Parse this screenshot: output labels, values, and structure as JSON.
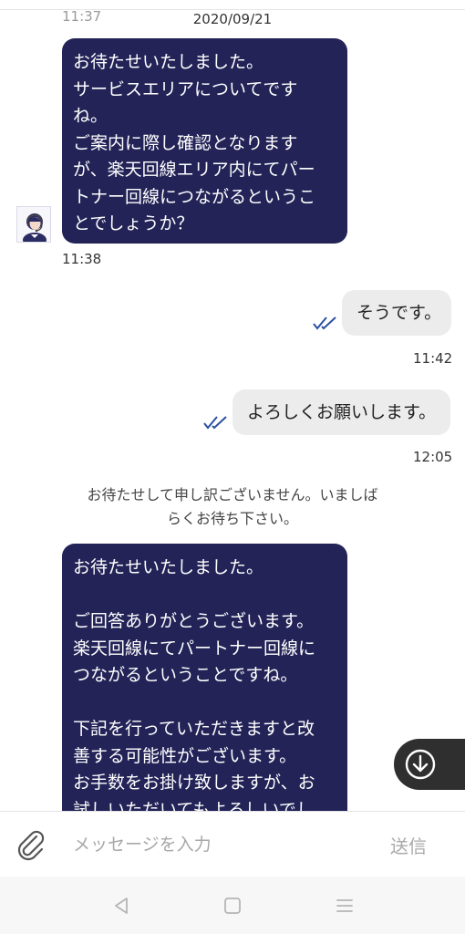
{
  "chat": {
    "prev_time": "11:37",
    "date": "2020/09/21",
    "agent_message_1": "お待たせいたしました。\nサービスエリアについてです\nね。\nご案内に際し確認となります\nが、楽天回線エリア内にてパー\nトナー回線につながるというこ\nとでしょうか？",
    "agent_time_1": "11:38",
    "user_message_1": "そうです。",
    "user_time_1": "11:42",
    "user_message_2": "よろしくお願いします。",
    "user_time_2": "12:05",
    "system_message": "お待たせして申し訳ございません。いましば\nらくお待ち下さい。",
    "agent_message_2": "お待たせいたしました。\n\nご回答ありがとうございます。\n楽天回線にてパートナー回線に\nつながるということですね。\n\n下記を行っていただきますと改\n善する可能性がございます。\nお手数をお掛け致しますが、お\n試しいただいてもよろしいでし"
  },
  "input": {
    "placeholder": "メッセージを入力",
    "send_label": "送信"
  },
  "icons": {
    "attach": "paperclip-icon",
    "read": "double-check-icon",
    "scroll_down": "arrow-down-circle-icon",
    "nav_back": "back-triangle-icon",
    "nav_home": "home-square-icon",
    "nav_menu": "menu-lines-icon"
  },
  "colors": {
    "agent_bubble": "#232358",
    "user_bubble": "#ececec",
    "read_check": "#2a4fa0"
  }
}
